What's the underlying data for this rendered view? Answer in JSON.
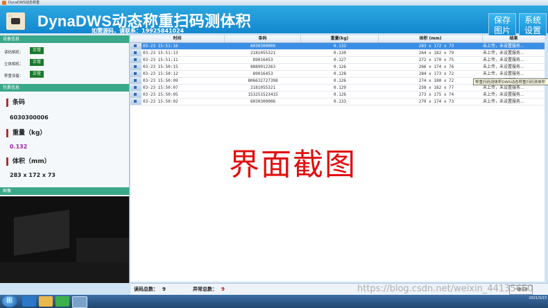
{
  "window": {
    "title": "DynaDWS动态称重"
  },
  "header": {
    "title": "DynaDWS动态称重扫码测体积",
    "subtitle": "如需源码，请联系：19925841024",
    "save_button": "保存\n图片",
    "settings_button": "系统\n设置"
  },
  "device": {
    "section_title": "设备信息",
    "rows": [
      {
        "label": "读码相机：",
        "status": "正常"
      },
      {
        "label": "立体相机：",
        "status": "正常"
      },
      {
        "label": "称重设备：",
        "status": "正常"
      }
    ]
  },
  "package": {
    "section_title": "包裹信息",
    "barcode_label": "条码",
    "barcode_value": "6030300006",
    "weight_label": "重量（kg）",
    "weight_value": "0.132",
    "volume_label": "体积（mm）",
    "volume_value": "283 x 172 x 73"
  },
  "image_section": {
    "title": "图像"
  },
  "table": {
    "columns": [
      "时间",
      "条码",
      "重量(kg)",
      "体积 (mm)",
      "结果"
    ],
    "rows": [
      {
        "time": "03-23 15:51:16",
        "code": "6030300006",
        "weight": "0.132",
        "volume": "283 x 172 x 73",
        "result": "未上传，未设置服务...",
        "selected": true
      },
      {
        "time": "03-23 15:51:13",
        "code": "2181055321",
        "weight": "0.130",
        "volume": "264 x 182 x 79",
        "result": "未上传，未设置服务..."
      },
      {
        "time": "03-23 15:51:11",
        "code": "89016453",
        "weight": "0.127",
        "volume": "272 x 170 x 75",
        "result": "未上传，未设置服务..."
      },
      {
        "time": "03-23 15:50:15",
        "code": "8889012263",
        "weight": "0.126",
        "volume": "266 x 174 x 76",
        "result": "未上传，未设置服务..."
      },
      {
        "time": "03-23 15:50:12",
        "code": "89016453",
        "weight": "0.128",
        "volume": "284 x 173 x 72",
        "result": "未上传，未设置服务..."
      },
      {
        "time": "03-23 15:50:09",
        "code": "806632727398",
        "weight": "0.126",
        "volume": "274 x 180 x 72",
        "result": "未上传，未设置服务..."
      },
      {
        "time": "03-23 15:50:07",
        "code": "2181055321",
        "weight": "0.129",
        "volume": "258 x 182 x 77",
        "result": "未上传，未设置服务..."
      },
      {
        "time": "03-23 15:50:05",
        "code": "153251523415",
        "weight": "0.126",
        "volume": "273 x 175 x 74",
        "result": "未上传，未设置服务..."
      },
      {
        "time": "03-23 15:50:02",
        "code": "6030300006",
        "weight": "0.133",
        "volume": "279 x 174 x 73",
        "result": "未上传，未设置服务..."
      }
    ]
  },
  "tooltip": "称重扫码测体积DWS动态称重扫码测体积",
  "overlay_text": "界面截图",
  "footer": {
    "read_total_label": "读码总数：",
    "read_total": "9",
    "error_total_label": "异常总数：",
    "error_total": "9",
    "clear_button": "一键清零"
  },
  "csdn_watermark": "https://blog.csdn.net/weixin_44135650",
  "taskbar": {
    "apps": [
      "ie-icon",
      "folder-icon",
      "wechat-icon",
      "dynadws-icon"
    ],
    "clock_time": "2021/3/23"
  },
  "colors": {
    "header": "#1a94d8",
    "section_header": "#3aa88a",
    "status_ok": "#1a7a2c",
    "weight_value": "#9b1fa3",
    "selected_row": "#3b8ee6",
    "overlay_text": "#e01010",
    "error_count": "#d01010"
  }
}
